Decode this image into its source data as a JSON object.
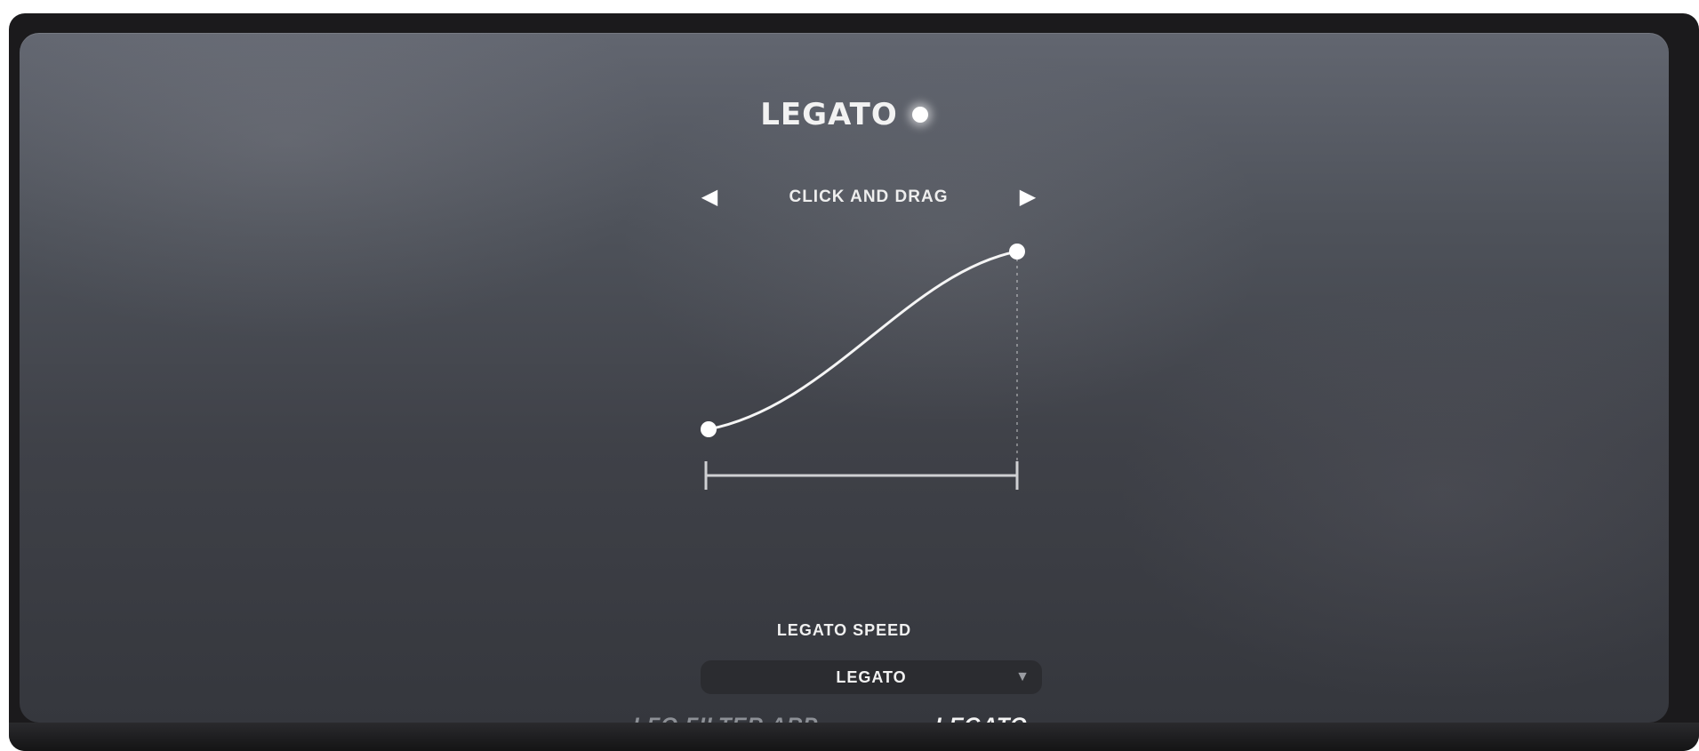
{
  "panel": {
    "title": "LEGATO",
    "selector": {
      "label": "CLICK AND DRAG",
      "prev_icon": "triangle-left-icon",
      "next_icon": "triangle-right-icon"
    },
    "speed": {
      "label": "LEGATO SPEED",
      "value": "LEGATO",
      "caret_icon": "triangle-down-icon"
    },
    "tabs": [
      {
        "label": "LFO.FILTER.ARP",
        "active": false
      },
      {
        "label": "LEGATO",
        "active": true
      }
    ]
  },
  "colors": {
    "panel_top": "#626670",
    "panel_bottom": "#35373d",
    "text": "#f2f2f2",
    "inactive_tab": "#8d9096"
  }
}
